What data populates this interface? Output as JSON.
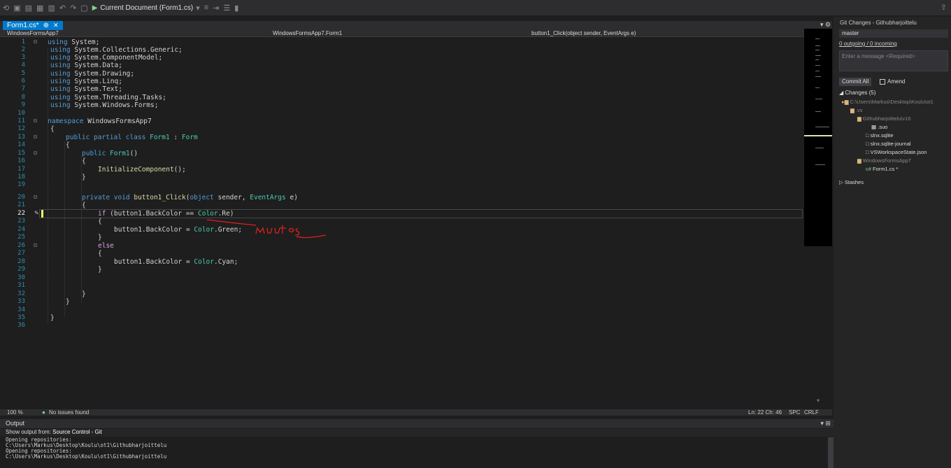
{
  "toolbar": {
    "run_label": "Current Document (Form1.cs)"
  },
  "editor": {
    "tab_label": "Form1.cs*",
    "nav": {
      "project": "WindowsFormsApp7",
      "class": "WindowsFormsApp7.Form1",
      "member": "button1_Click(object sender, EventArgs e)"
    },
    "line_numbers": [
      "1",
      "2",
      "3",
      "4",
      "5",
      "6",
      "7",
      "8",
      "9",
      "10",
      "11",
      "12",
      "13",
      "14",
      "15",
      "16",
      "17",
      "18",
      "19",
      "20",
      "21",
      "22",
      "23",
      "24",
      "25",
      "26",
      "27",
      "28",
      "29",
      "30",
      "31",
      "32",
      "33",
      "34",
      "35",
      "36"
    ],
    "code": {
      "l1_kw": "using",
      "l1": " System;",
      "l2_kw": "using",
      "l2": " System.Collections.Generic;",
      "l3_kw": "using",
      "l3": " System.ComponentModel;",
      "l4_kw": "using",
      "l4": " System.Data;",
      "l5_kw": "using",
      "l5": " System.Drawing;",
      "l6_kw": "using",
      "l6": " System.Linq;",
      "l7_kw": "using",
      "l7": " System.Text;",
      "l8_kw": "using",
      "l8": " System.Threading.Tasks;",
      "l9_kw": "using",
      "l9": " System.Windows.Forms;",
      "l11_kw": "namespace",
      "l11": " WindowsFormsApp7",
      "l12": "{",
      "l13_kw": "public partial class",
      "l13_ty": " Form1",
      "l13_p": " : ",
      "l13_ty2": "Form",
      "l14": "{",
      "l15_kw": "public",
      "l15_ty": " Form1",
      "l15_p": "()",
      "l16": "{",
      "l17_fn": "InitializeComponent",
      "l17_p": "();",
      "l18": "}",
      "l20_kw": "private void",
      "l20_fn": " button1_Click",
      "l20_p1": "(",
      "l20_kw2": "object",
      "l20_p2": " sender, ",
      "l20_ty": "EventArgs",
      "l20_p3": " e)",
      "l21": "{",
      "l22_kw": "if",
      "l22_p": " (button1.BackColor == ",
      "l22_ty": "Color",
      "l22_p2": ".Re)",
      "l23": "{",
      "l24_p": "button1.BackColor = ",
      "l24_ty": "Color",
      "l24_p2": ".Green;",
      "l25": "}",
      "l26_kw": "else",
      "l27": "{",
      "l28_p": "button1.BackColor = ",
      "l28_ty": "Color",
      "l28_p2": ".Cyan;",
      "l29": "}",
      "l32": "}",
      "l33": "}",
      "l35": "}"
    },
    "handwritten_annotation": "muutos"
  },
  "statusbar": {
    "zoom": "100 %",
    "issues": "No issues found",
    "position": "Ln: 22  Ch: 46",
    "spc": "SPC",
    "eol": "CRLF"
  },
  "output": {
    "title": "Output",
    "show_from_label": "Show output from:",
    "source": "Source Control - Git",
    "lines": "Opening repositories:\nC:\\Users\\Markus\\Desktop\\Koulu\\ot1\\Githubharjoittelu\nOpening repositories:\nC:\\Users\\Markus\\Desktop\\Koulu\\ot1\\Githubharjoittelu"
  },
  "git": {
    "title": "Git Changes - Githubharjoittelu",
    "branch": "master",
    "sync": "0 outgoing / 0 incoming",
    "message_placeholder": "Enter a message <Required>",
    "commit_button": "Commit All",
    "amend_label": "Amend",
    "changes_header": "Changes (5)",
    "tree": {
      "root": "C:\\Users\\Markus\\Desktop\\Koulu\\ot1",
      "vs": ".vs",
      "folder1": "Githubharjoittelu\\v16",
      "suo": ".suo",
      "f1": "slnx.sqlite",
      "f2": "slnx.sqlite-journal",
      "f3": "VSWorkspaceState.json",
      "folder2": "WindowsFormsApp7",
      "form": "Form1.cs *"
    },
    "stashes": "Stashes"
  }
}
